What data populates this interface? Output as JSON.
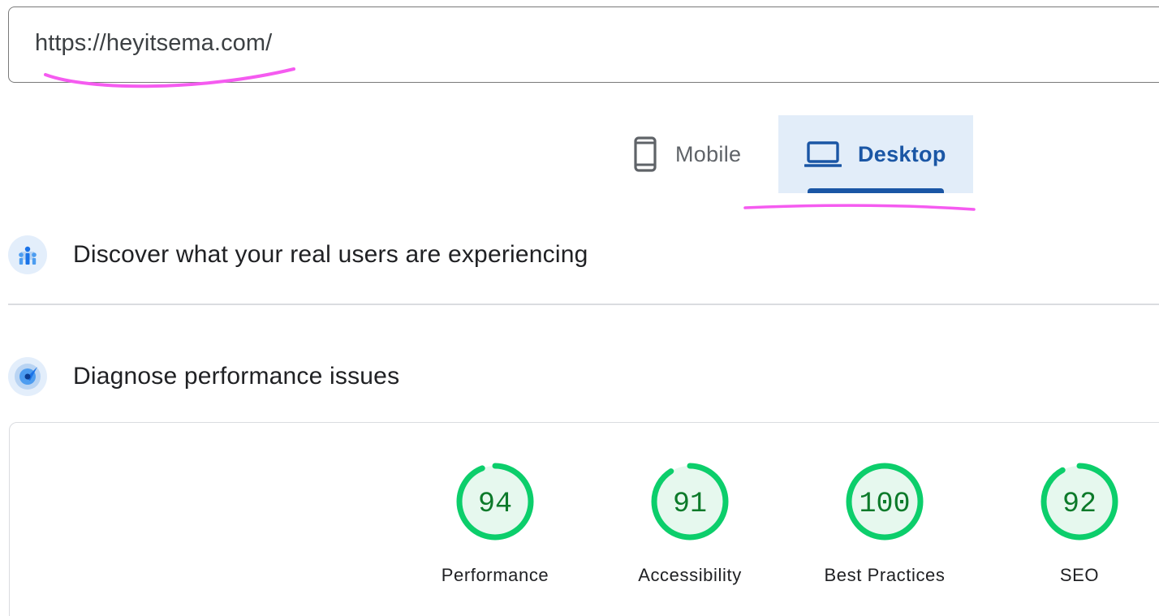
{
  "url_input": {
    "value": "https://heyitsema.com/"
  },
  "tabs": [
    {
      "label": "Mobile",
      "icon": "phone-icon",
      "selected": false
    },
    {
      "label": "Desktop",
      "icon": "laptop-icon",
      "selected": true
    }
  ],
  "sections": {
    "real_users": {
      "title": "Discover what your real users are experiencing",
      "icon": "users-chart-icon"
    },
    "diagnose": {
      "title": "Diagnose performance issues",
      "icon": "compass-icon"
    }
  },
  "scores": [
    {
      "value": 94,
      "label": "Performance"
    },
    {
      "value": 91,
      "label": "Accessibility"
    },
    {
      "value": 100,
      "label": "Best Practices"
    },
    {
      "value": 92,
      "label": "SEO"
    }
  ],
  "colors": {
    "pass_green": "#0cce6b",
    "pass_fill": "#e6f8ee",
    "pass_text": "#0c7a2a",
    "accent_blue": "#1a56a5",
    "tab_selected_bg": "#e2edf9",
    "annotation_pink": "#f55bf0"
  }
}
